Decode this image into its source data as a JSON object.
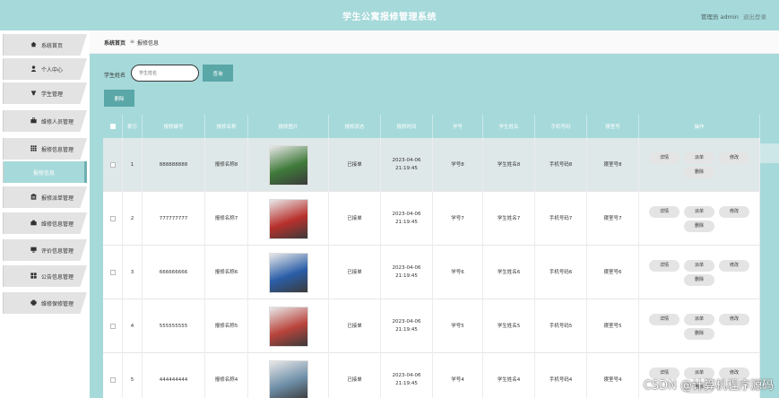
{
  "header": {
    "title": "学生公寓报修管理系统",
    "user_label": "管理员 admin",
    "logout": "退出登录"
  },
  "sidebar": {
    "items": [
      {
        "label": "系统首页",
        "icon": "home-icon"
      },
      {
        "label": "个人中心",
        "icon": "user-icon"
      },
      {
        "label": "学生管理",
        "icon": "student-icon"
      },
      {
        "label": "维修人员管理",
        "icon": "briefcase-icon"
      },
      {
        "label": "报修信息管理",
        "icon": "grid-icon"
      },
      {
        "label": "报修信息",
        "icon": "",
        "active": true
      },
      {
        "label": "报修派单管理",
        "icon": "clipboard-icon"
      },
      {
        "label": "维修信息管理",
        "icon": "wrench-icon"
      },
      {
        "label": "评价信息管理",
        "icon": "monitor-icon"
      },
      {
        "label": "公告信息管理",
        "icon": "apps-icon"
      },
      {
        "label": "维修保修管理",
        "icon": "printer-icon"
      }
    ]
  },
  "breadcrumb": {
    "home": "系统首页",
    "separator": "≡",
    "current": "报修信息"
  },
  "search": {
    "label": "学生姓名",
    "placeholder": "学生姓名",
    "query_button": "查询",
    "delete_button": "删除"
  },
  "table": {
    "columns": [
      "",
      "索引",
      "报修编号",
      "报修名称",
      "报修图片",
      "报修状态",
      "报修时间",
      "学号",
      "学生姓名",
      "手机号码",
      "寝室号",
      "操作"
    ],
    "rows": [
      {
        "index": "1",
        "code": "888888888",
        "name": "报修名称8",
        "status": "已接单",
        "time": "2023-04-06 21:19:45",
        "student_no": "学号8",
        "student_name": "学生姓名8",
        "phone": "手机号码8",
        "room": "寝室号8",
        "photo_color": "#3f7a3a"
      },
      {
        "index": "2",
        "code": "777777777",
        "name": "报修名称7",
        "status": "已接单",
        "time": "2023-04-06 21:19:45",
        "student_no": "学号7",
        "student_name": "学生姓名7",
        "phone": "手机号码7",
        "room": "寝室号7",
        "photo_color": "#b8302c"
      },
      {
        "index": "3",
        "code": "666666666",
        "name": "报修名称6",
        "status": "已接单",
        "time": "2023-04-06 21:19:45",
        "student_no": "学号6",
        "student_name": "学生姓名6",
        "phone": "手机号码6",
        "room": "寝室号6",
        "photo_color": "#2a5ea8"
      },
      {
        "index": "4",
        "code": "555555555",
        "name": "报修名称5",
        "status": "已接单",
        "time": "2023-04-06 21:19:45",
        "student_no": "学号5",
        "student_name": "学生姓名5",
        "phone": "手机号码5",
        "room": "寝室号5",
        "photo_color": "#b9443c"
      },
      {
        "index": "5",
        "code": "444444444",
        "name": "报修名称4",
        "status": "已接单",
        "time": "2023-04-06 21:19:45",
        "student_no": "学号4",
        "student_name": "学生姓名4",
        "phone": "手机号码4",
        "room": "寝室号4",
        "photo_color": "#6e8fa8"
      }
    ],
    "actions": [
      "详情",
      "派单",
      "修改",
      "删除"
    ]
  },
  "watermark": "CSDN @计算机程序源码",
  "colors": {
    "header": "#a6d9da",
    "button": "#5aa7a8",
    "row_hover": "#dfe8e8"
  }
}
